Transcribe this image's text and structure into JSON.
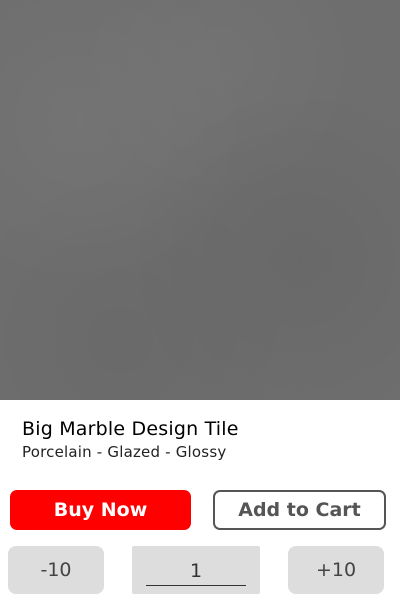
{
  "product": {
    "title": "Big Marble Design Tile",
    "subtitle": "Porcelain - Glazed - Glossy",
    "image_color": "#6e6e6e"
  },
  "actions": {
    "buy_now_label": "Buy Now",
    "add_to_cart_label": "Add to Cart",
    "accent_color": "#ff0000"
  },
  "quantity": {
    "decrement_label": "-10",
    "increment_label": "+10",
    "value": "1"
  }
}
